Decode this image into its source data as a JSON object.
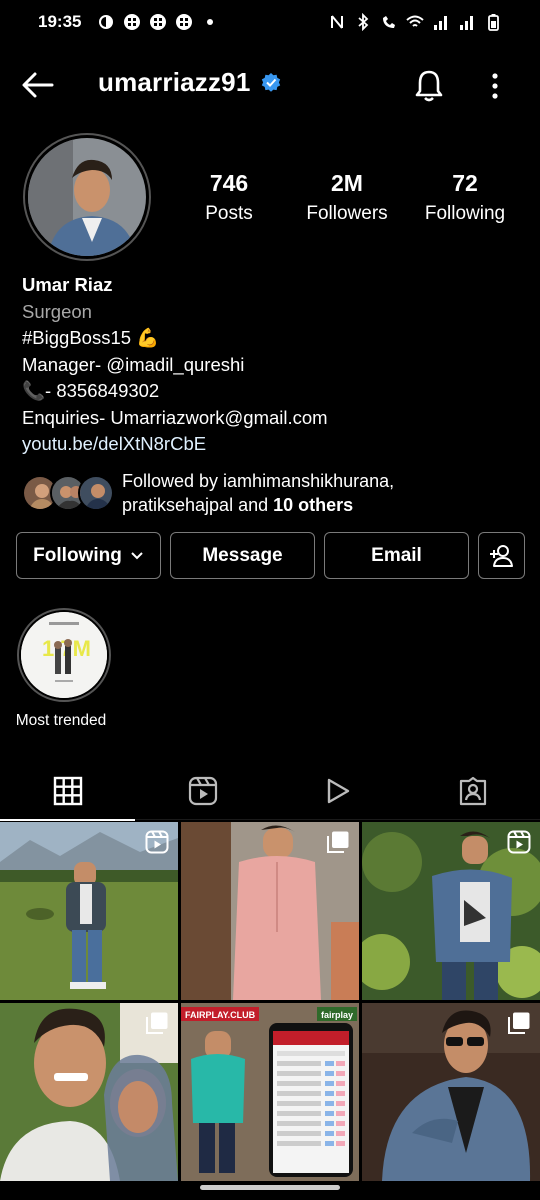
{
  "status_bar": {
    "time": "19:35",
    "left_icons": [
      "data-saver-icon",
      "app-icon",
      "app-icon",
      "app-icon",
      "dot-icon"
    ],
    "right_icons": [
      "nfc-icon",
      "bluetooth-icon",
      "volte-icon",
      "wifi-icon",
      "signal-icon",
      "signal-icon",
      "battery-icon"
    ]
  },
  "header": {
    "username": "umarriazz91",
    "verified": true
  },
  "profile": {
    "stats": [
      {
        "num": "746",
        "label": "Posts"
      },
      {
        "num": "2M",
        "label": "Followers"
      },
      {
        "num": "72",
        "label": "Following"
      }
    ]
  },
  "bio": {
    "name": "Umar Riaz",
    "category": "Surgeon",
    "lines": [
      "#BiggBoss15 💪",
      "Manager-  @imadil_qureshi",
      "📞- 8356849302",
      "Enquiries- Umarriazwork@gmail.com"
    ],
    "link": "youtu.be/delXtN8rCbE"
  },
  "followed_by": {
    "line1": "Followed by iamhimanshikhurana,",
    "line2_prefix": "pratiksehajpal and ",
    "line2_bold": "10 others"
  },
  "buttons": {
    "following": "Following",
    "message": "Message",
    "email": "Email"
  },
  "highlights": [
    {
      "label": "Most trended",
      "cover_text": "1.7M"
    }
  ],
  "tabs": [
    "grid-icon",
    "reels-icon",
    "video-play-icon",
    "tagged-icon"
  ],
  "grid": [
    {
      "badge": "reels-icon",
      "scene": "outdoor-meadow"
    },
    {
      "badge": "multi-icon",
      "scene": "pink-kurta"
    },
    {
      "badge": "reels-icon",
      "scene": "forest-denim"
    },
    {
      "badge": "multi-icon",
      "scene": "selfie-mother"
    },
    {
      "badge": "",
      "scene": "fairplay-ad",
      "ad_brand": "FAIRPLAY.CLUB",
      "ad_brand_right": "fairplay"
    },
    {
      "badge": "multi-icon",
      "scene": "denim-sunglasses"
    }
  ],
  "colors": {
    "background": "#000000",
    "verified_blue": "#3897f0",
    "secondary_text": "#a8a8a8",
    "button_border": "#7a7a7a"
  }
}
